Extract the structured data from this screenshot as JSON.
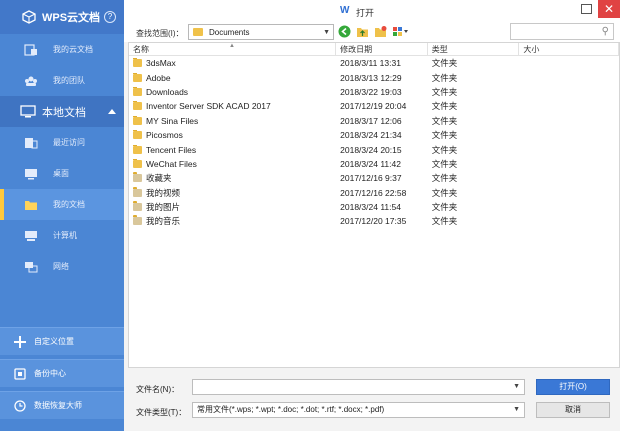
{
  "sidebar": {
    "title": "WPS云文档",
    "help": "?",
    "cloud_items": [
      {
        "label": "我的云文档",
        "icon": "cloud-doc-icon"
      },
      {
        "label": "我的团队",
        "icon": "team-icon"
      }
    ],
    "local_section": "本地文档",
    "local_items": [
      {
        "label": "最近访问",
        "icon": "recent-icon"
      },
      {
        "label": "桌面",
        "icon": "desktop-icon"
      },
      {
        "label": "我的文档",
        "icon": "folder-icon"
      },
      {
        "label": "计算机",
        "icon": "computer-icon"
      },
      {
        "label": "网络",
        "icon": "network-icon"
      }
    ],
    "bottom_items": [
      {
        "label": "自定义位置",
        "icon": "plus-icon"
      },
      {
        "label": "备份中心",
        "icon": "backup-icon"
      },
      {
        "label": "数据恢复大师",
        "icon": "recovery-icon"
      }
    ]
  },
  "dialog": {
    "title": "打开",
    "lookin_label": "查找范围(I)：",
    "lookin_value": "Documents",
    "search_placeholder": ""
  },
  "columns": [
    "名称",
    "修改日期",
    "类型",
    "大小"
  ],
  "files": [
    {
      "name": "3dsMax",
      "date": "2018/3/11 13:31",
      "type": "文件夹",
      "size": ""
    },
    {
      "name": "Adobe",
      "date": "2018/3/13 12:29",
      "type": "文件夹",
      "size": ""
    },
    {
      "name": "Downloads",
      "date": "2018/3/22 19:03",
      "type": "文件夹",
      "size": ""
    },
    {
      "name": "Inventor Server SDK ACAD 2017",
      "date": "2017/12/19 20:04",
      "type": "文件夹",
      "size": ""
    },
    {
      "name": "MY Sina Files",
      "date": "2018/3/17 12:06",
      "type": "文件夹",
      "size": ""
    },
    {
      "name": "Picosmos",
      "date": "2018/3/24 21:34",
      "type": "文件夹",
      "size": ""
    },
    {
      "name": "Tencent Files",
      "date": "2018/3/24 20:15",
      "type": "文件夹",
      "size": ""
    },
    {
      "name": "WeChat Files",
      "date": "2018/3/24 11:42",
      "type": "文件夹",
      "size": ""
    },
    {
      "name": "收藏夹",
      "date": "2017/12/16 9:37",
      "type": "文件夹",
      "size": ""
    },
    {
      "name": "我的视频",
      "date": "2017/12/16 22:58",
      "type": "文件夹",
      "size": ""
    },
    {
      "name": "我的图片",
      "date": "2018/3/24 11:54",
      "type": "文件夹",
      "size": ""
    },
    {
      "name": "我的音乐",
      "date": "2017/12/20 17:35",
      "type": "文件夹",
      "size": ""
    }
  ],
  "footer": {
    "filename_label": "文件名(N)：",
    "filename_value": "",
    "filetype_label": "文件类型(T)：",
    "filetype_value": "常用文件(*.wps; *.wpt; *.doc; *.dot; *.rtf; *.docx; *.pdf)",
    "open_button": "打开(O)",
    "cancel_button": "取消"
  },
  "colors": {
    "sidebar_bg": "#4b86d4",
    "accent": "#3a78d6",
    "folder": "#efc14a",
    "active_marker": "#ffc93c",
    "close": "#e04343"
  }
}
